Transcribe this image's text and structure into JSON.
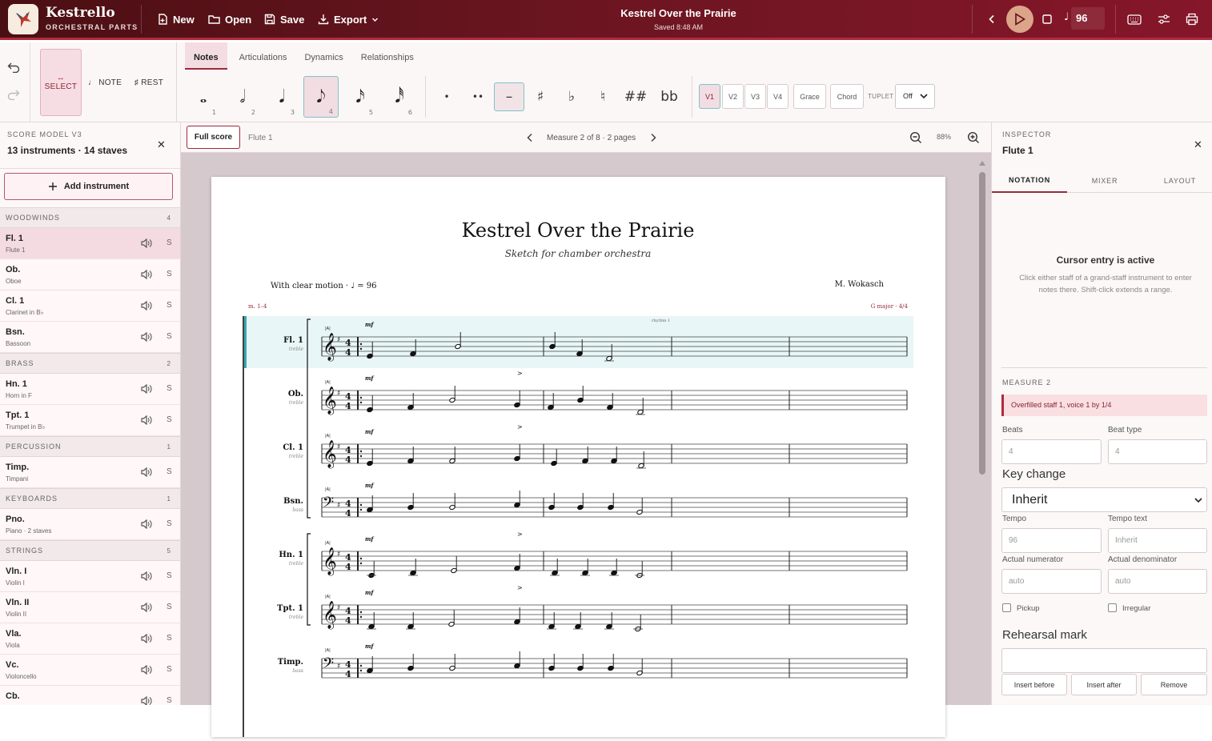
{
  "app": {
    "name": "Kestrello",
    "subtitle": "ORCHESTRAL PARTS"
  },
  "menu": {
    "new": "New",
    "open": "Open",
    "save": "Save",
    "export": "Export"
  },
  "document": {
    "title": "Kestrel Over the Prairie",
    "status": "Saved 8:48 AM"
  },
  "transport": {
    "tempo": "96"
  },
  "modes": {
    "select": "↔ SELECT",
    "note": "♩ NOTE",
    "rest": "♯ REST"
  },
  "tabs": [
    "Notes",
    "Articulations",
    "Dynamics",
    "Relationships"
  ],
  "durations": [
    {
      "glyph": "𝅝",
      "num": "1"
    },
    {
      "glyph": "𝅗𝅥",
      "num": "2"
    },
    {
      "glyph": "𝅘𝅥",
      "num": "3"
    },
    {
      "glyph": "𝅘𝅥𝅮",
      "num": "4"
    },
    {
      "glyph": "𝅘𝅥𝅯",
      "num": "5"
    },
    {
      "glyph": "𝅘𝅥𝅰",
      "num": "6"
    }
  ],
  "modifiers": [
    "•",
    "••",
    "–",
    "♯",
    "♭",
    "♮",
    "##",
    "bb"
  ],
  "voices": [
    "V1",
    "V2",
    "V3",
    "V4"
  ],
  "voice_tools": {
    "grace": "Grace",
    "chord": "Chord",
    "tuplet_label": "TUPLET",
    "tuplet_value": "Off"
  },
  "left_panel": {
    "kicker": "SCORE MODEL V3",
    "summary": "13 instruments · 14 staves",
    "add_label": "Add instrument",
    "groups": [
      {
        "name": "WOODWINDS",
        "count": "4",
        "items": [
          {
            "abbr": "Fl. 1",
            "name": "Flute 1"
          },
          {
            "abbr": "Ob.",
            "name": "Oboe"
          },
          {
            "abbr": "Cl. 1",
            "name": "Clarinet in B♭"
          },
          {
            "abbr": "Bsn.",
            "name": "Bassoon"
          }
        ]
      },
      {
        "name": "BRASS",
        "count": "2",
        "items": [
          {
            "abbr": "Hn. 1",
            "name": "Horn in F"
          },
          {
            "abbr": "Tpt. 1",
            "name": "Trumpet in B♭"
          }
        ]
      },
      {
        "name": "PERCUSSION",
        "count": "1",
        "items": [
          {
            "abbr": "Timp.",
            "name": "Timpani"
          }
        ]
      },
      {
        "name": "KEYBOARDS",
        "count": "1",
        "items": [
          {
            "abbr": "Pno.",
            "name": "Piano · 2 staves"
          }
        ]
      },
      {
        "name": "STRINGS",
        "count": "5",
        "items": [
          {
            "abbr": "Vln. I",
            "name": "Violin I"
          },
          {
            "abbr": "Vln. II",
            "name": "Violin II"
          },
          {
            "abbr": "Vla.",
            "name": "Viola"
          },
          {
            "abbr": "Vc.",
            "name": "Violoncello"
          },
          {
            "abbr": "Cb.",
            "name": ""
          }
        ]
      }
    ],
    "solo_label": "S"
  },
  "canvas_bar": {
    "full_score": "Full score",
    "part": "Flute 1",
    "measure": "Measure 2 of 8 · 2 pages",
    "zoom": "88%"
  },
  "score": {
    "title": "Kestrel Over the Prairie",
    "subtitle": "Sketch for chamber orchestra",
    "tempo_text": "With clear motion · ♩ = 96",
    "composer": "M. Wokasch",
    "range": "m. 1–4",
    "key": "G major · 4/4",
    "rehearsal": "rhythm 1",
    "section_mark": "|A|",
    "dyn": "mf",
    "accent": ">",
    "staves": [
      {
        "abbr": "Fl. 1",
        "clef": "treble"
      },
      {
        "abbr": "Ob.",
        "clef": "treble"
      },
      {
        "abbr": "Cl. 1",
        "clef": "treble"
      },
      {
        "abbr": "Bsn.",
        "clef": "bass"
      },
      {
        "abbr": "Hn. 1",
        "clef": "treble"
      },
      {
        "abbr": "Tpt. 1",
        "clef": "treble"
      },
      {
        "abbr": "Timp.",
        "clef": "bass"
      }
    ]
  },
  "inspector": {
    "kicker": "INSPECTOR",
    "target": "Flute 1",
    "tabs": [
      "NOTATION",
      "MIXER",
      "LAYOUT"
    ],
    "cursor_title": "Cursor entry is active",
    "cursor_body": "Click either staff of a grand-staff instrument to enter notes there. Shift-click extends a range.",
    "measure_label": "MEASURE 2",
    "warning": "Overfilled staff 1, voice 1 by 1/4",
    "beats_label": "Beats",
    "beats_value": "4",
    "beat_type_label": "Beat type",
    "beat_type_value": "4",
    "key_change_label": "Key change",
    "key_change_value": "Inherit",
    "tempo_label": "Tempo",
    "tempo_value": "96",
    "tempo_text_label": "Tempo text",
    "tempo_text_placeholder": "Inherit",
    "num_label": "Actual numerator",
    "num_placeholder": "auto",
    "den_label": "Actual denominator",
    "den_placeholder": "auto",
    "pickup": "Pickup",
    "irregular": "Irregular",
    "rehearsal_label": "Rehearsal mark",
    "insert_before": "Insert before",
    "insert_after": "Insert after",
    "remove": "Remove"
  },
  "colors": {
    "accent": "#9a2a3c",
    "header_start": "#4a0f12",
    "header_end": "#86162a",
    "selection": "#e8f6f7"
  }
}
